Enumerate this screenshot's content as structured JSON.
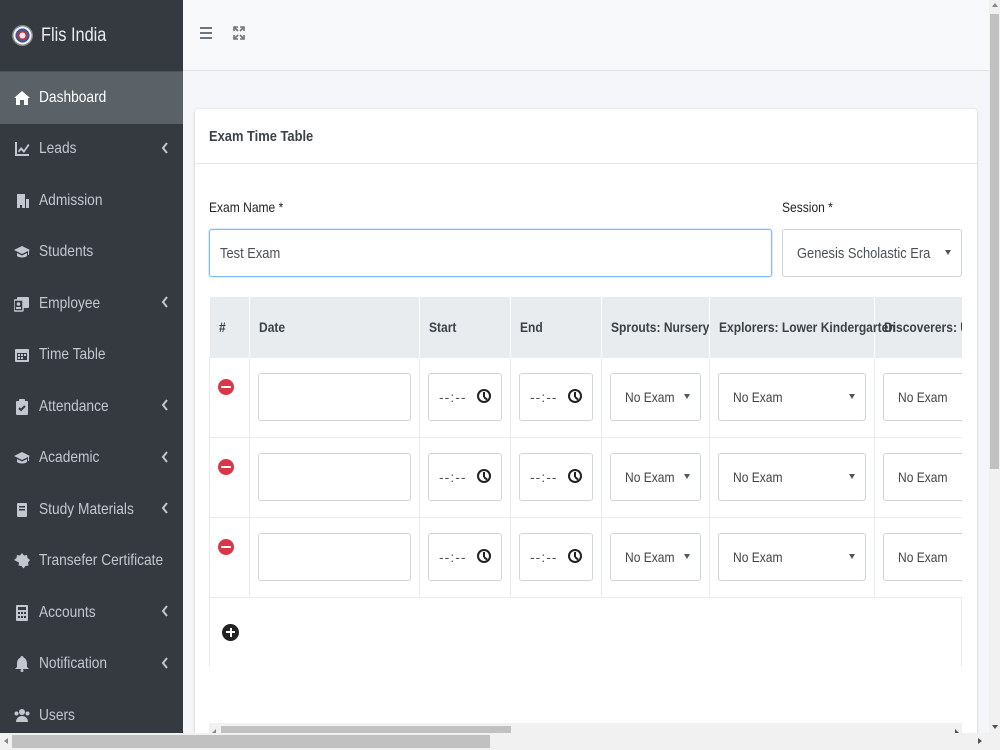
{
  "brand": {
    "name": "Flis India"
  },
  "sidebar": {
    "items": [
      {
        "label": "Dashboard",
        "icon": "home-icon",
        "active": true,
        "has_chevron": false
      },
      {
        "label": "Leads",
        "icon": "chart-line-icon",
        "has_chevron": true
      },
      {
        "label": "Admission",
        "icon": "building-icon",
        "has_chevron": false
      },
      {
        "label": "Students",
        "icon": "graduation-cap-icon",
        "has_chevron": false
      },
      {
        "label": "Employee",
        "icon": "id-card-icon",
        "has_chevron": true
      },
      {
        "label": "Time Table",
        "icon": "calendar-icon",
        "has_chevron": false
      },
      {
        "label": "Attendance",
        "icon": "clipboard-check-icon",
        "has_chevron": true
      },
      {
        "label": "Academic",
        "icon": "graduation-cap-icon",
        "has_chevron": true
      },
      {
        "label": "Study Materials",
        "icon": "book-icon",
        "has_chevron": true
      },
      {
        "label": "Transefer Certificate",
        "icon": "certificate-icon",
        "has_chevron": false
      },
      {
        "label": "Accounts",
        "icon": "calculator-icon",
        "has_chevron": true
      },
      {
        "label": "Notification",
        "icon": "bell-icon",
        "has_chevron": true
      },
      {
        "label": "Users",
        "icon": "users-icon",
        "has_chevron": false
      }
    ]
  },
  "topbar": {
    "menu_icon": "hamburger-icon",
    "fullscreen_icon": "expand-icon"
  },
  "card": {
    "title": "Exam Time Table",
    "exam_name_label": "Exam Name *",
    "exam_name_value": "Test Exam",
    "session_label": "Session *",
    "session_value": "Genesis Scholastic Era"
  },
  "table": {
    "headers": [
      "#",
      "Date",
      "Start",
      "End",
      "Sprouts: Nursery",
      "Explorers: Lower Kindergarten",
      "Discoverers: Upper Kindergarten"
    ],
    "rows": [
      {
        "date": "",
        "start": "--:--",
        "end": "--:--",
        "sprouts": "No Exam",
        "explorers": "No Exam",
        "discoverers": "No Exam"
      },
      {
        "date": "",
        "start": "--:--",
        "end": "--:--",
        "sprouts": "No Exam",
        "explorers": "No Exam",
        "discoverers": "No Exam"
      },
      {
        "date": "",
        "start": "--:--",
        "end": "--:--",
        "sprouts": "No Exam",
        "explorers": "No Exam",
        "discoverers": "No Exam"
      }
    ]
  },
  "colors": {
    "sidebar_bg": "#343a40",
    "active_item": "#5a6268",
    "remove_button": "#dc3545",
    "focus_border": "#80bdff"
  }
}
